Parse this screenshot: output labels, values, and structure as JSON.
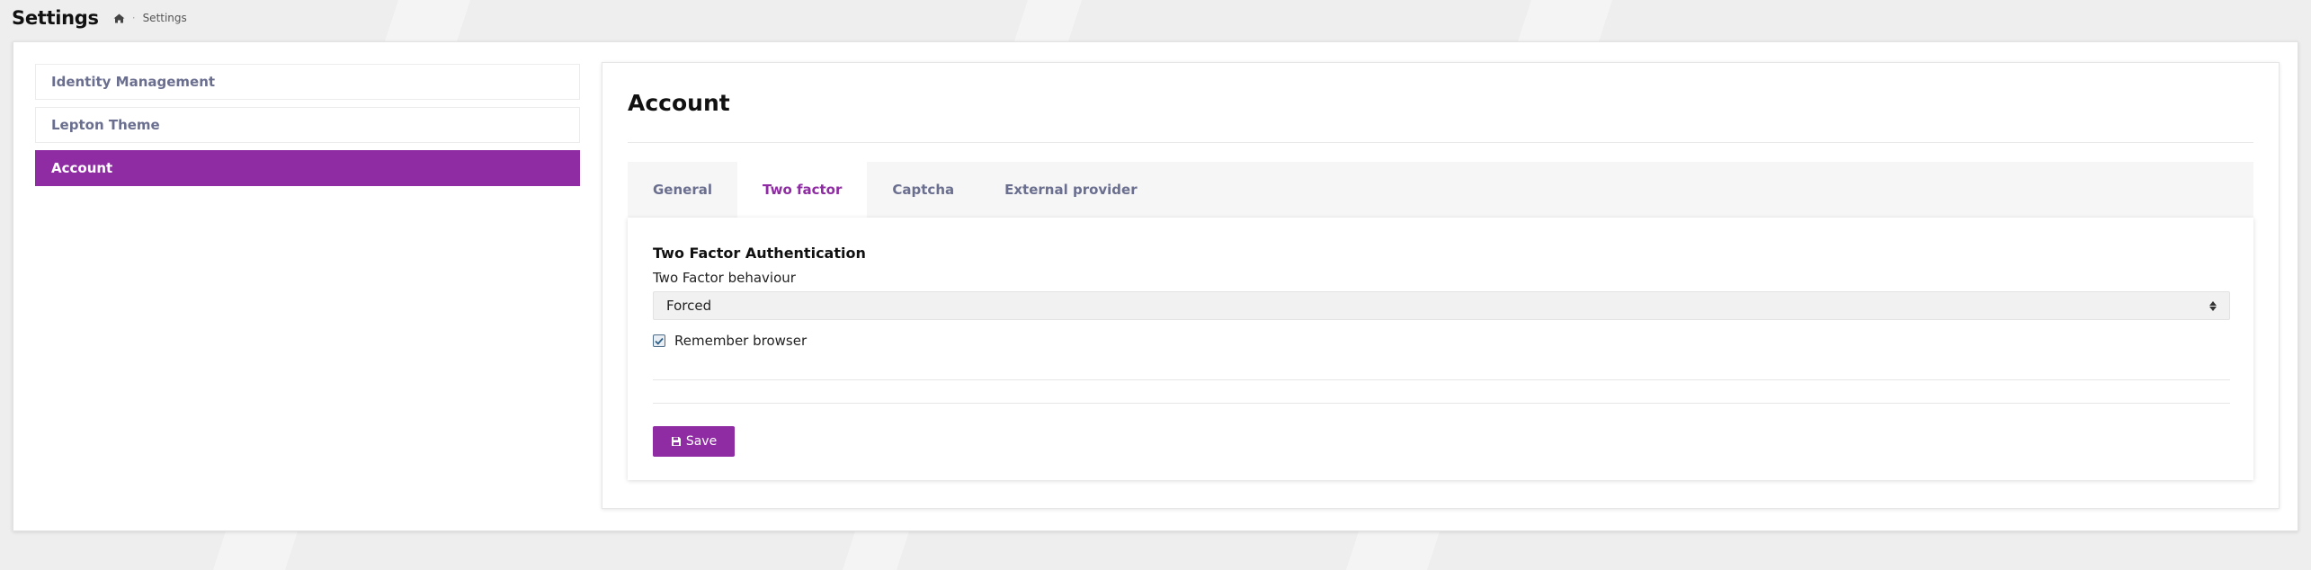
{
  "header": {
    "title": "Settings",
    "breadcrumb": {
      "home_icon": "home-icon",
      "separator": "·",
      "current": "Settings"
    }
  },
  "sidebar": {
    "items": [
      {
        "label": "Identity Management",
        "active": false
      },
      {
        "label": "Lepton Theme",
        "active": false
      },
      {
        "label": "Account",
        "active": true
      }
    ]
  },
  "content": {
    "title": "Account",
    "tabs": [
      {
        "label": "General",
        "active": false
      },
      {
        "label": "Two factor",
        "active": true
      },
      {
        "label": "Captcha",
        "active": false
      },
      {
        "label": "External provider",
        "active": false
      }
    ],
    "two_factor": {
      "heading": "Two Factor Authentication",
      "behaviour_label": "Two Factor behaviour",
      "behaviour_value": "Forced",
      "remember_browser_label": "Remember browser",
      "remember_browser_checked": true,
      "save_label": "Save",
      "save_icon": "save-icon"
    }
  },
  "colors": {
    "accent": "#8f2ba3",
    "nav_text": "#6b6f8f",
    "background": "#eeeeee"
  }
}
